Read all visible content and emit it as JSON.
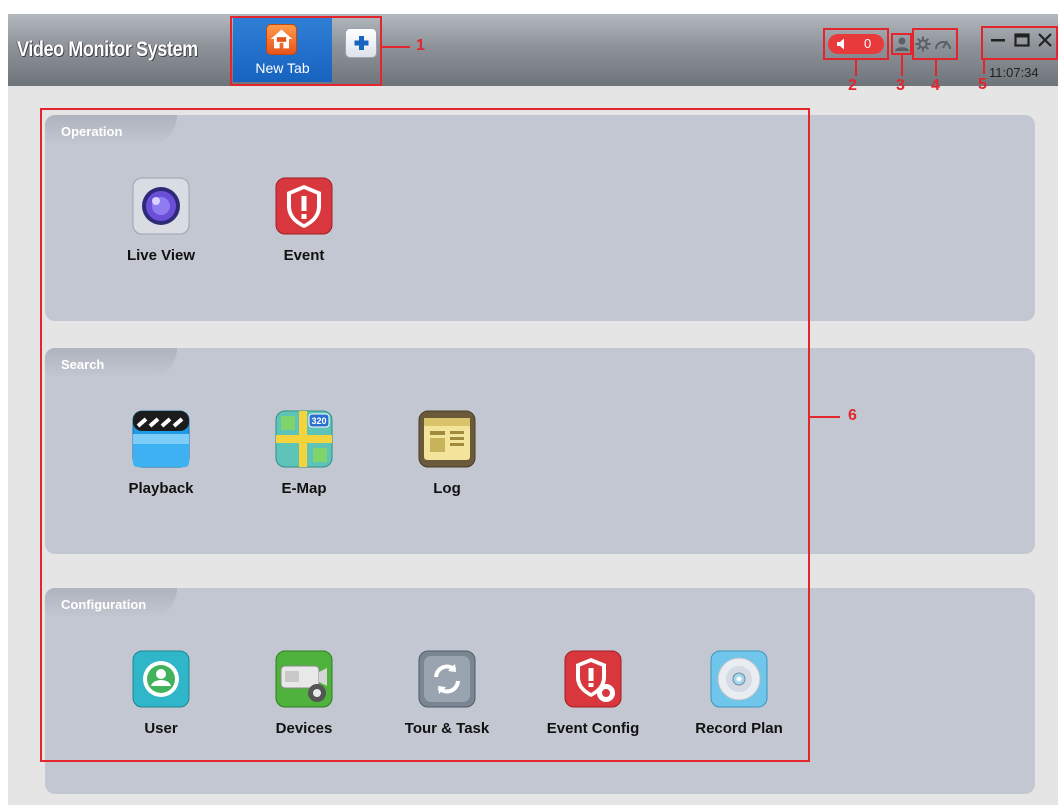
{
  "app": {
    "title": "Video Monitor System"
  },
  "tabs": {
    "active_label": "New Tab",
    "add_icon": "plus-icon"
  },
  "toolbar": {
    "alarm_count": "0",
    "alarm_icon": "speaker-icon",
    "user_icon": "user-icon",
    "settings_icon": "gear-icon",
    "performance_icon": "gauge-icon",
    "clock": "11:07:34"
  },
  "callouts": [
    "1",
    "2",
    "3",
    "4",
    "5",
    "6"
  ],
  "sections": {
    "operation": {
      "label": "Operation",
      "items": [
        {
          "label": "Live View",
          "icon": "camera-icon"
        },
        {
          "label": "Event",
          "icon": "alert-shield-icon"
        }
      ]
    },
    "search": {
      "label": "Search",
      "items": [
        {
          "label": "Playback",
          "icon": "clapperboard-icon"
        },
        {
          "label": "E-Map",
          "icon": "map-icon",
          "badge": "320"
        },
        {
          "label": "Log",
          "icon": "log-icon"
        }
      ]
    },
    "configuration": {
      "label": "Configuration",
      "items": [
        {
          "label": "User",
          "icon": "user-icon"
        },
        {
          "label": "Devices",
          "icon": "device-gear-icon"
        },
        {
          "label": "Tour & Task",
          "icon": "refresh-icon"
        },
        {
          "label": "Event Config",
          "icon": "alert-gear-icon"
        },
        {
          "label": "Record Plan",
          "icon": "disc-icon"
        }
      ]
    }
  },
  "colors": {
    "titlebar": "#8e939a",
    "tab_active": "#1763c0",
    "annotation_red": "#e3262d",
    "panel": "#c2c7d1",
    "background": "#e5e5e6"
  }
}
